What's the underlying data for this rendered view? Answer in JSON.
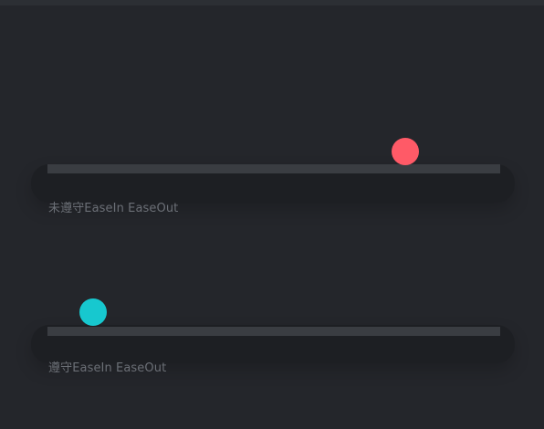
{
  "demos": [
    {
      "label": "未遵守EaseIn EaseOut",
      "ball_color": "#ff5a67",
      "position_fraction": 0.79
    },
    {
      "label": "遵守EaseIn EaseOut",
      "ball_color": "#17c8cf",
      "position_fraction": 0.1
    }
  ],
  "colors": {
    "background": "#24262b",
    "track": "#3a3d42",
    "label": "#6b6f76"
  }
}
